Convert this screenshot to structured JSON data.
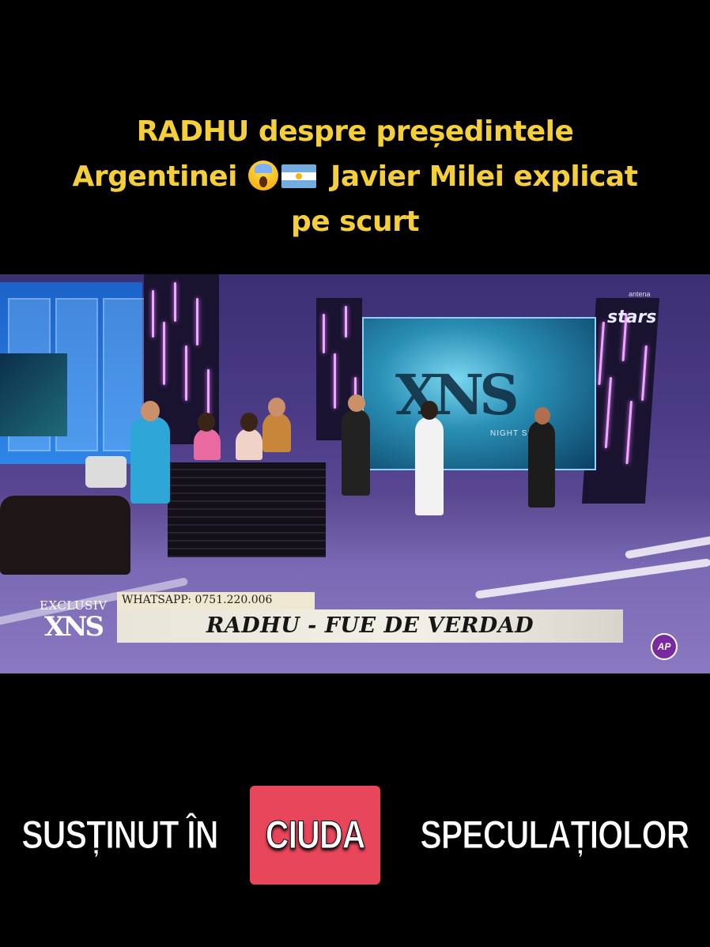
{
  "top_caption": {
    "line1": "RADHU despre președintele",
    "line2_start": "Argentinei",
    "line2_end": "Javier Milei explicat",
    "line3": "pe scurt",
    "emoji_scream": "face-screaming-icon",
    "flag": "argentina-flag-icon"
  },
  "video": {
    "channel_logo": "stars",
    "channel_network": "antena",
    "screen_logo": "XNS",
    "screen_subtitle": "NIGHT SHOW",
    "lower_third": {
      "label": "EXCLUSIV",
      "show_logo": "XNS",
      "whatsapp": "WHATSAPP: 0751.220.006",
      "title": "RADHU - FUE DE VERDAD"
    },
    "badge": "AP"
  },
  "bottom_caption": {
    "word1": "SUSȚINUT ÎN",
    "highlight": "CIUDA",
    "word3": "SPECULAȚIOLOR"
  }
}
